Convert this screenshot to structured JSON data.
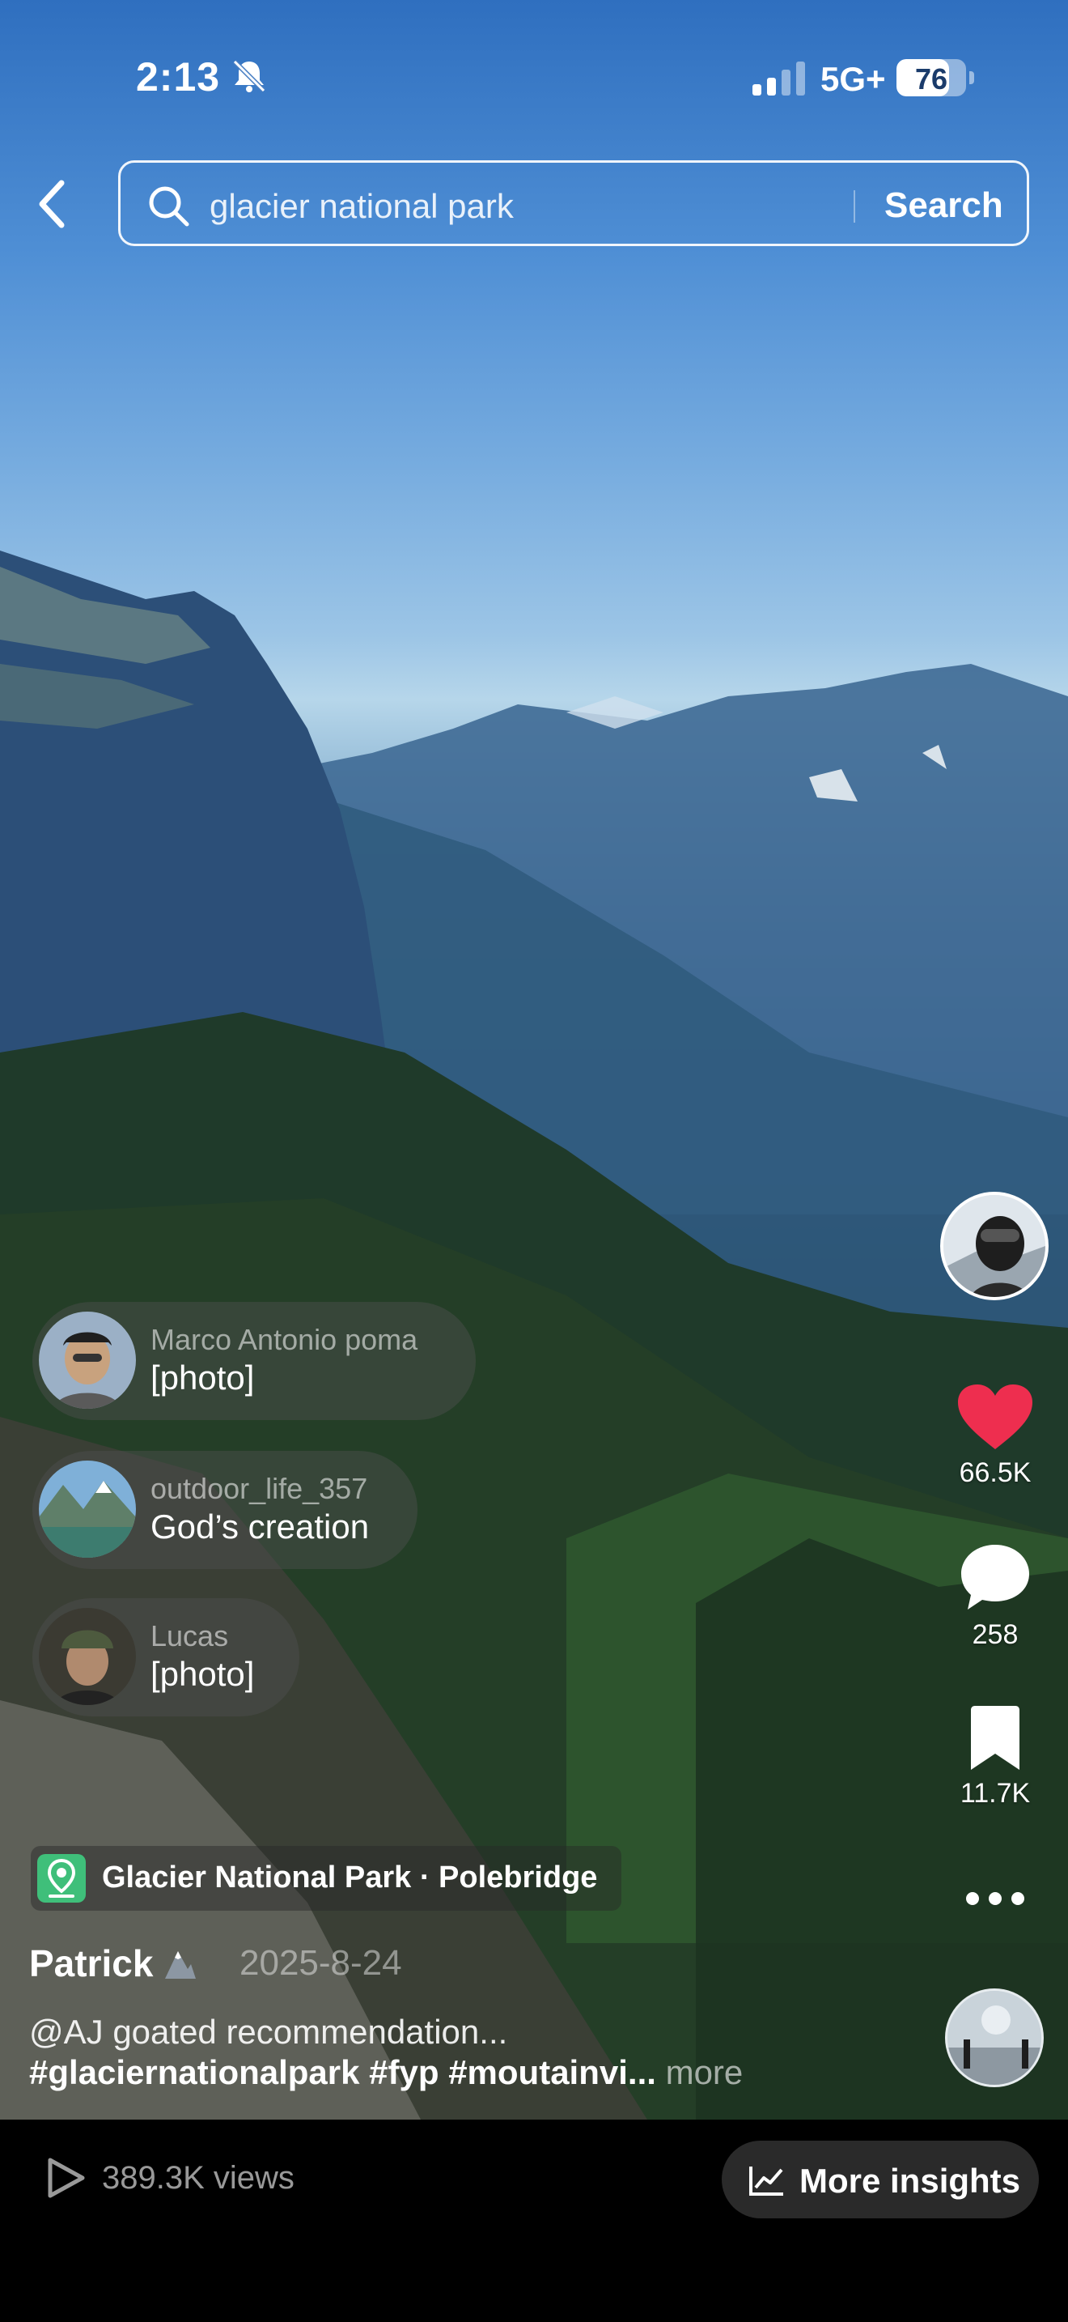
{
  "status_bar": {
    "time": "2:13",
    "network": "5G+",
    "battery": "76",
    "battery_level": 0.76,
    "icons": [
      "bell-slash-icon",
      "signal-icon",
      "battery-icon"
    ]
  },
  "search": {
    "query": "glacier national park",
    "button_label": "Search",
    "icons": [
      "back-chevron-icon",
      "search-icon"
    ]
  },
  "actions": {
    "likes": "66.5K",
    "comments": "258",
    "saves": "11.7K",
    "like_color": "#ee2e4f",
    "icons": [
      "heart-icon",
      "comment-icon",
      "bookmark-icon",
      "more-icon"
    ]
  },
  "comments": [
    {
      "name": "Marco Antonio poma",
      "text": "[photo]"
    },
    {
      "name": "outdoor_life_357",
      "text": "God’s creation"
    },
    {
      "name": "Lucas",
      "text": "[photo]"
    }
  ],
  "location": {
    "label": "Glacier National Park · Polebridge",
    "color": "#3fbf7a",
    "icon": "location-pin-icon"
  },
  "post": {
    "author": "Patrick",
    "date": "2025-8-24",
    "caption_line1": "@AJ goated recommendation...",
    "caption_line2": "#glaciernationalpark #fyp #moutainvi...",
    "more_label": " more"
  },
  "footer": {
    "views": "389.3K views",
    "insights_label": "More insights",
    "icons": [
      "play-icon",
      "chart-icon"
    ]
  }
}
